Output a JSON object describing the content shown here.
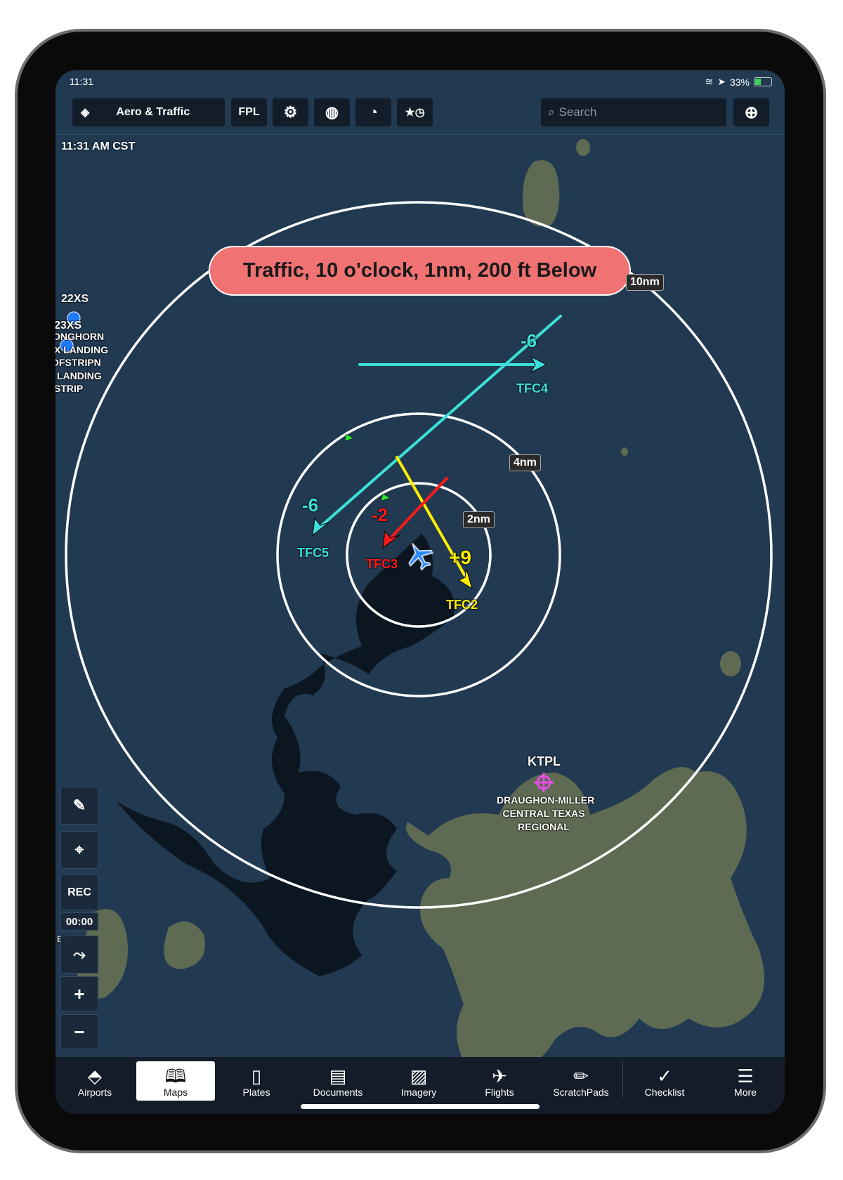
{
  "status_bar": {
    "time": "11:31",
    "battery": "33%",
    "battery_level": 0.33
  },
  "toolbar": {
    "layers_label": "Aero & Traffic",
    "fpl": "FPL",
    "search_placeholder": "Search"
  },
  "map": {
    "time_label": "11:31 AM CST",
    "banner": "Traffic, 10 o'clock, 1nm, 200 ft Below",
    "rings": [
      "2nm",
      "4nm",
      "10nm"
    ],
    "traffic": [
      {
        "id": "TFC2",
        "alt": "+9",
        "color": "#ffee00"
      },
      {
        "id": "TFC3",
        "alt": "-2",
        "color": "#ff1a1a"
      },
      {
        "id": "TFC4",
        "alt": "-6",
        "color": "#3de0d8"
      },
      {
        "id": "TFC5",
        "alt": "-6",
        "color": "#3de0d8"
      }
    ],
    "airports": {
      "left_labels": [
        "22XS",
        "23XS",
        "ONGHORN",
        "X LANDING",
        "OFSTRIPN",
        "LANDING",
        "STRIP"
      ],
      "ktpl": {
        "code": "KTPL",
        "name": [
          "DRAUGHON-MILLER",
          "CENTRAL TEXAS",
          "REGIONAL"
        ]
      },
      "eld": "ELD"
    }
  },
  "controls": {
    "rec": "REC",
    "timer": "00:00"
  },
  "bottom_nav": [
    {
      "label": "Airports",
      "icon": "compass-icon"
    },
    {
      "label": "Maps",
      "icon": "map-icon",
      "active": true
    },
    {
      "label": "Plates",
      "icon": "plate-icon"
    },
    {
      "label": "Documents",
      "icon": "documents-icon"
    },
    {
      "label": "Imagery",
      "icon": "imagery-icon"
    },
    {
      "label": "Flights",
      "icon": "flight-icon"
    },
    {
      "label": "ScratchPads",
      "icon": "pencil-icon"
    },
    {
      "label": "Checklist",
      "icon": "check-icon"
    },
    {
      "label": "More",
      "icon": "menu-icon"
    }
  ]
}
